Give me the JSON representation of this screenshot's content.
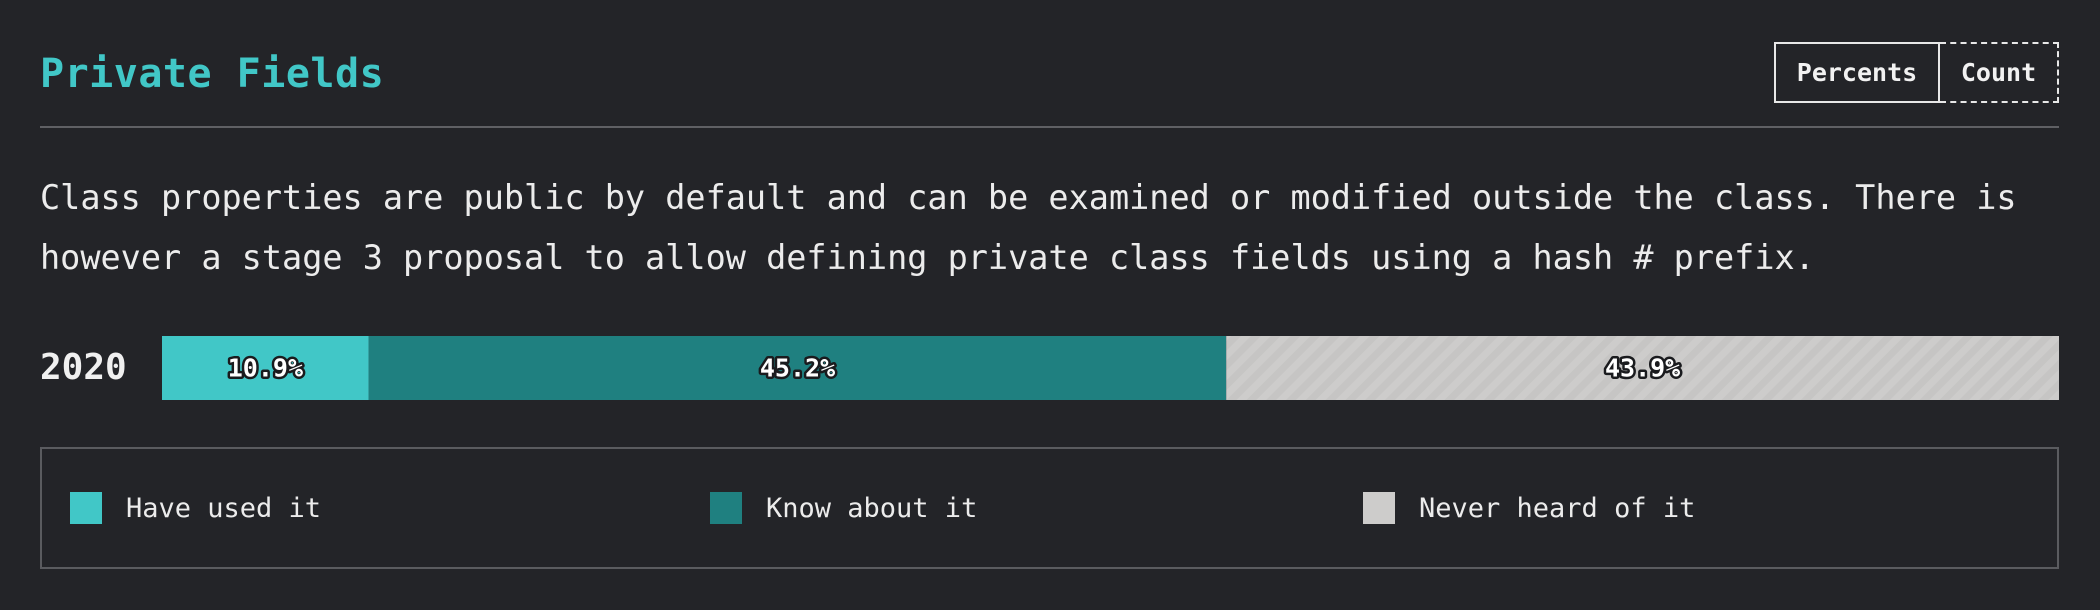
{
  "header": {
    "title": "Private Fields"
  },
  "toggle": {
    "percents_label": "Percents",
    "count_label": "Count",
    "active": "Percents"
  },
  "description": "Class properties are public by default and can be examined or modified outside the class. There is however a stage 3 proposal to allow defining private class fields using a hash # prefix.",
  "chart_data": {
    "type": "bar",
    "orientation": "horizontal",
    "stacked": true,
    "categories": [
      "2020"
    ],
    "series": [
      {
        "name": "Have used it",
        "values": [
          10.9
        ],
        "color": "#41c7c7"
      },
      {
        "name": "Know about it",
        "values": [
          45.2
        ],
        "color": "#1f8080"
      },
      {
        "name": "Never heard of it",
        "values": [
          43.9
        ],
        "color": "#cdcccb",
        "pattern": "hatched"
      }
    ],
    "value_labels": [
      "10.9%",
      "45.2%",
      "43.9%"
    ],
    "legend": [
      "Have used it",
      "Know about it",
      "Never heard of it"
    ],
    "legend_position": "bottom",
    "unit": "%"
  }
}
